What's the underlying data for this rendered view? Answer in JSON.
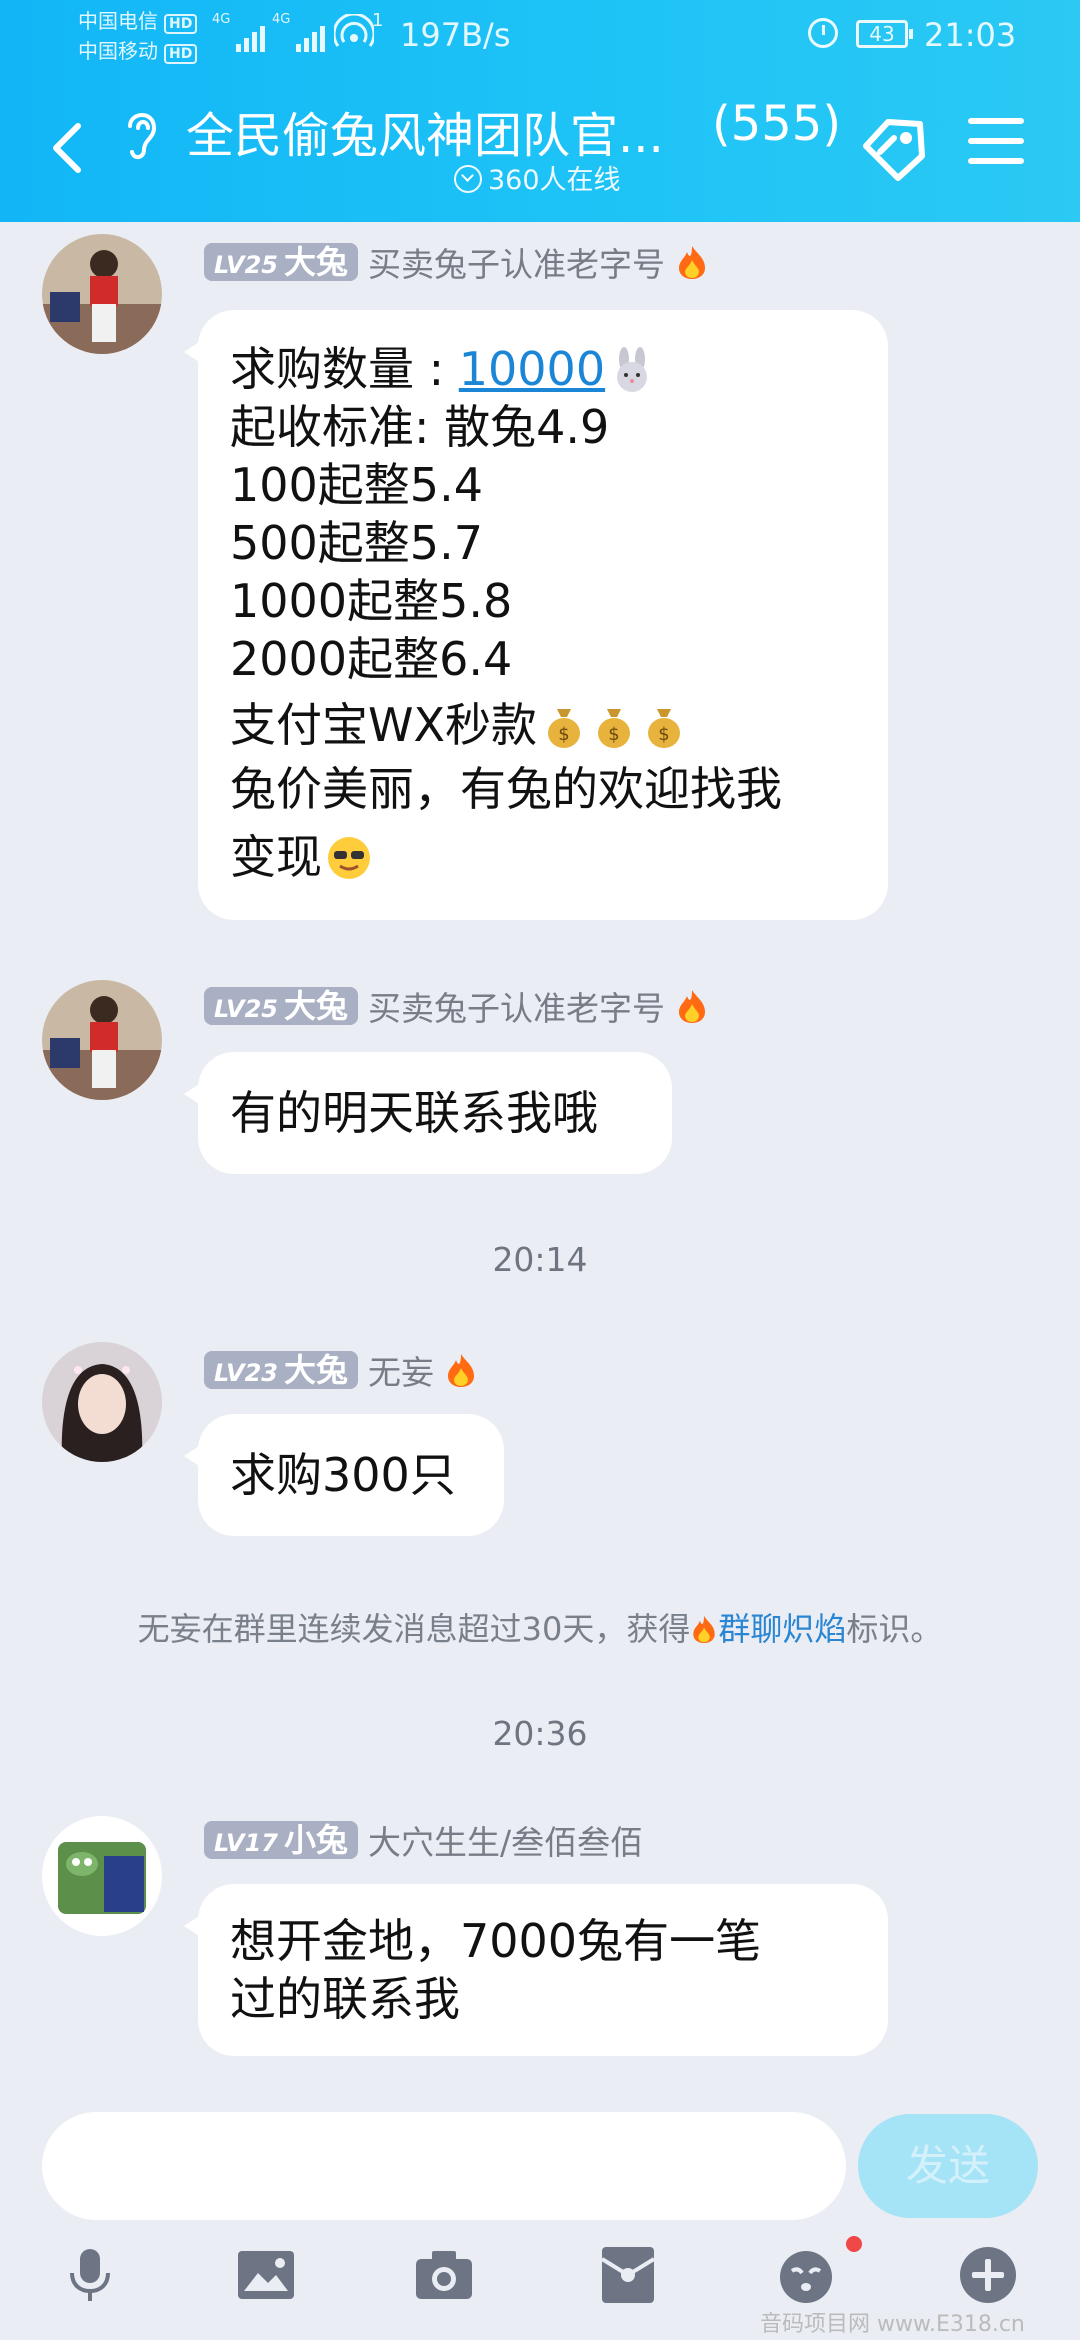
{
  "status_bar": {
    "carrier1": "中国电信",
    "carrier2": "中国移动",
    "hd": "HD",
    "net_type": "4G",
    "wifi_level": "1",
    "net_speed": "197B/s",
    "battery": "43",
    "time": "21:03"
  },
  "header": {
    "title": "全民偷兔风神团队官...",
    "member_count": "(555)",
    "online": "360人在线"
  },
  "colors": {
    "header_gradient_start": "#12b6f6",
    "header_gradient_end": "#2bc9f3",
    "background": "#eaedf4",
    "badge": "#a9b0c3",
    "link": "#1c86d6",
    "send_button": "#a4e4f6"
  },
  "messages": [
    {
      "badge_lv": "LV25",
      "badge_name": "大兔",
      "title": "买卖兔子认准老字号",
      "lines": {
        "l1_prefix": "求购数量 : ",
        "l1_link": "10000",
        "l2": "起收标准: 散兔4.9",
        "l3": "100起整5.4",
        "l4": "500起整5.7",
        "l5": "1000起整5.8",
        "l6": "2000起整6.4",
        "l7": "支付宝WX秒款",
        "l8": "兔价美丽，有兔的欢迎找我",
        "l9": "变现"
      }
    },
    {
      "badge_lv": "LV25",
      "badge_name": "大兔",
      "title": "买卖兔子认准老字号",
      "text": "有的明天联系我哦"
    },
    {
      "badge_lv": "LV23",
      "badge_name": "大兔",
      "title": "无妄",
      "text": "求购300只"
    },
    {
      "badge_lv": "LV17",
      "badge_name": "小兔",
      "title": "大穴生生/叁佰叁佰",
      "line1": "想开金地，7000兔有一笔",
      "line2": "过的联系我"
    }
  ],
  "timestamps": [
    "20:14",
    "20:36"
  ],
  "system_message": {
    "prefix": "无妄在群里连续发消息超过30天，获得",
    "highlight": "群聊炽焰",
    "suffix": "标识。"
  },
  "input": {
    "placeholder": "",
    "send_label": "发送"
  },
  "toolbar_icons": [
    "microphone-icon",
    "image-icon",
    "camera-icon",
    "red-packet-icon",
    "emoji-icon",
    "plus-icon"
  ],
  "watermark": "音码项目网 www.E318.cn"
}
